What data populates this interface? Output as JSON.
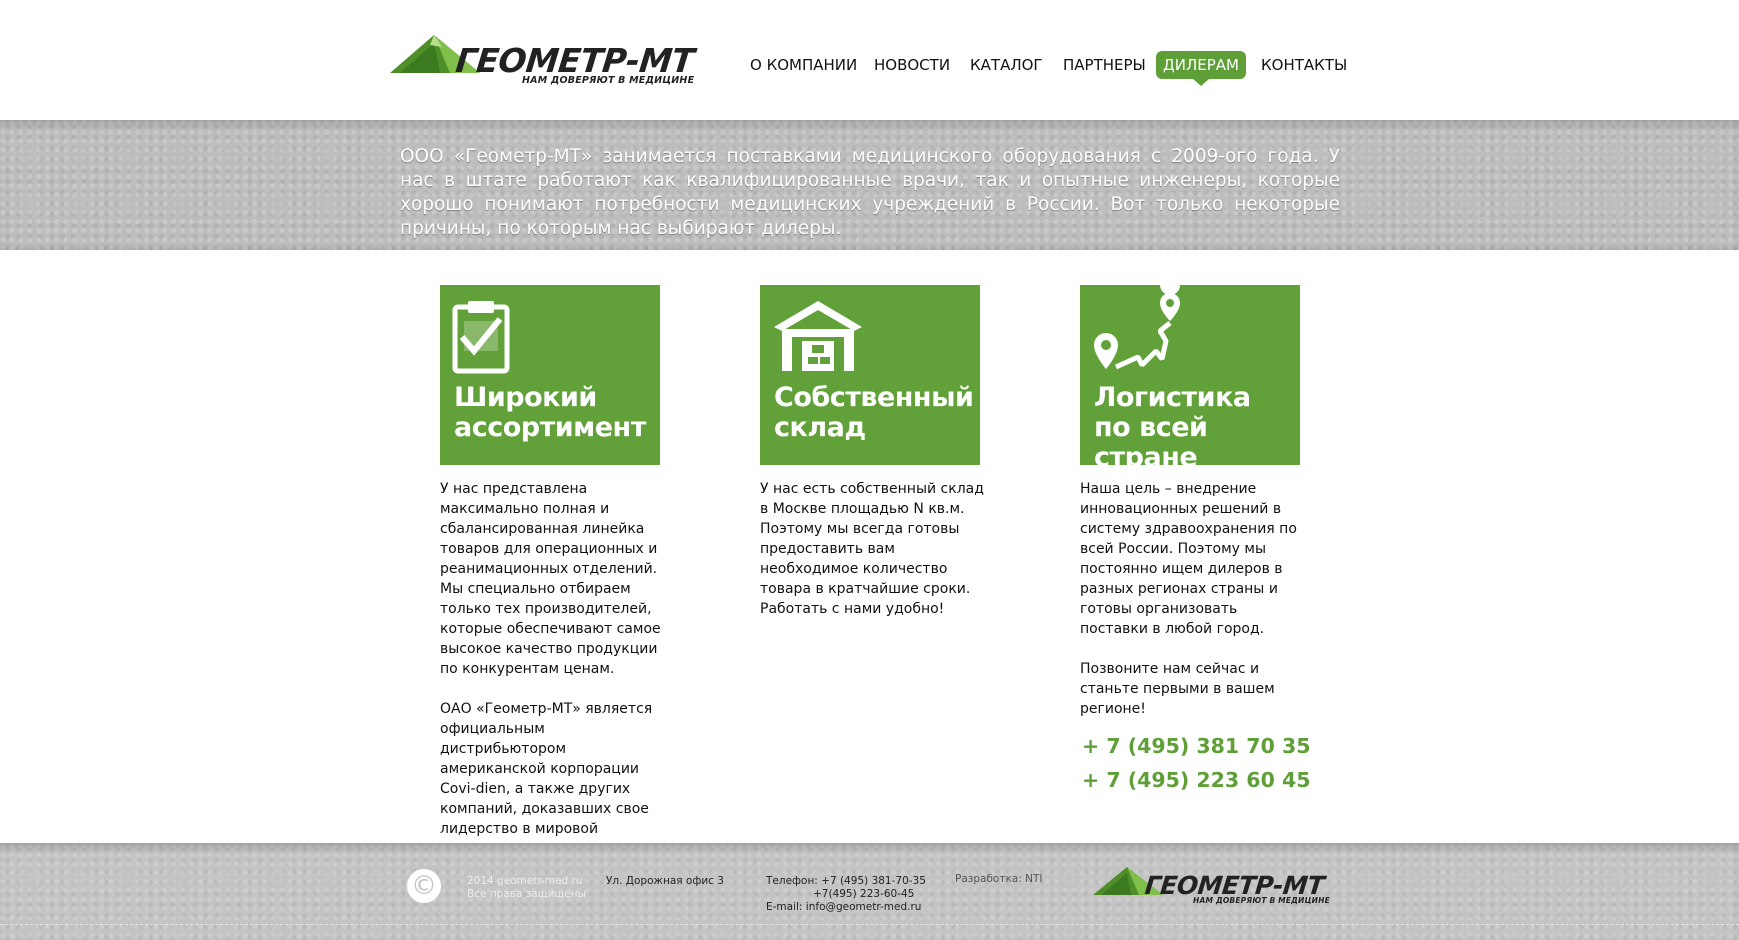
{
  "header": {
    "logo": {
      "name": "ГЕОМЕТР-МТ",
      "tagline": "НАМ ДОВЕРЯЮТ В МЕДИЦИНЕ"
    },
    "nav": [
      {
        "label": "О КОМПАНИИ"
      },
      {
        "label": "НОВОСТИ"
      },
      {
        "label": "КАТАЛОГ"
      },
      {
        "label": "ПАРТНЕРЫ"
      },
      {
        "label": "ДИЛЕРАМ",
        "active": true
      },
      {
        "label": "КОНТАКТЫ"
      }
    ]
  },
  "intro": {
    "text": "ООО «Геометр-МТ» занимается поставками медицинского оборудования с 2009-ого года. У нас в штате работают как квалифицированные врачи, так и опытные инженеры, которые хорошо понимают потребности медицинских учреждений в России. Вот только некоторые причины, по которым нас выбирают дилеры."
  },
  "features": [
    {
      "icon": "clipboard-check-icon",
      "title": "Широкий ассортимент",
      "paragraphs": [
        "У нас представлена максимально полная и сбалансированная линейка товаров для операционных и реанимационных отделений. Мы специально отбираем только тех производителей, которые обеспечивают самое высокое качество продукции по конкурентам ценам.",
        "ОАО «Геометр-МТ» является официальным дистрибьютором американской корпорации Covi-dien, а также других компаний, доказавших свое лидерство в мировой медицине."
      ]
    },
    {
      "icon": "warehouse-icon",
      "title": "Собственный склад",
      "paragraphs": [
        "У нас есть собственный склад в Москве площадью N кв.м. Поэтому мы всегда готовы предоставить вам необходимое количество товара в кратчайшие сроки. Работать с нами удобно!"
      ]
    },
    {
      "icon": "route-map-icon",
      "title": "Логистика по всей стране",
      "paragraphs": [
        "Наша цель – внедрение инновационных решений в систему здравоохранения по всей России. Поэтому мы постоянно ищем дилеров в разных регионах страны и готовы организовать поставки в любой город.",
        "Позвоните нам сейчас и станьте первыми в вашем регионе!"
      ],
      "phones": [
        "+ 7 (495) 381 70 35",
        "+ 7 (495) 223 60 45"
      ]
    }
  ],
  "footer": {
    "copyright_symbol": "©",
    "copyright_line1": "2014 geometr-med.ru",
    "copyright_line2": "Все права защищены",
    "address": "Ул. Дорожная  офис 3",
    "phone_line1": "Телефон: +7 (495) 381-70-35",
    "phone_line2": "+7(495) 223-60-45",
    "email": "E-mail: info@geometr-med.ru",
    "developer": "Разработка: NTI",
    "logo": {
      "name": "ГЕОМЕТР-МТ",
      "tagline": "НАМ ДОВЕРЯЮТ В МЕДИЦИНЕ"
    }
  },
  "colors": {
    "brand_green": "#5f9f37",
    "card_green": "#62a03a",
    "band_gray": "#bdbdbd"
  }
}
